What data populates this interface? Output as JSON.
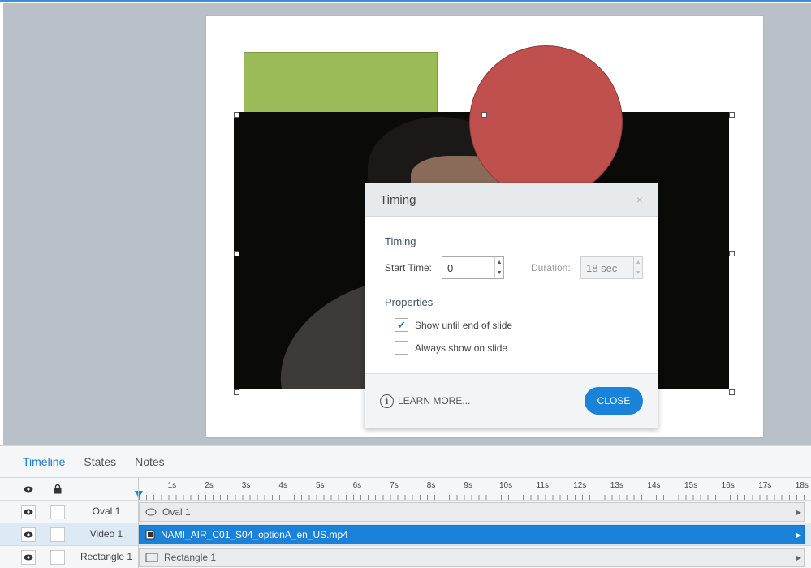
{
  "dialog": {
    "title": "Timing",
    "timing_section": "Timing",
    "start_time_label": "Start Time:",
    "start_time_value": "0",
    "duration_label": "Duration:",
    "duration_value": "18 sec",
    "properties_section": "Properties",
    "checkbox_show_until_end": {
      "label": "Show until end of slide",
      "checked": true
    },
    "checkbox_always_show": {
      "label": "Always show on slide",
      "checked": false
    },
    "learn_more": "LEARN MORE...",
    "close_button": "CLOSE",
    "close_icon": "×"
  },
  "panel": {
    "tabs": [
      {
        "label": "Timeline",
        "active": true
      },
      {
        "label": "States",
        "active": false
      },
      {
        "label": "Notes",
        "active": false
      }
    ],
    "ruler_labels": [
      "1s",
      "2s",
      "3s",
      "4s",
      "5s",
      "6s",
      "7s",
      "8s",
      "9s",
      "10s",
      "11s",
      "12s",
      "13s",
      "14s",
      "15s",
      "16s",
      "17s",
      "18s"
    ],
    "rows": [
      {
        "name": "Oval 1",
        "track_label": "Oval 1",
        "icon": "oval-icon",
        "selected": false
      },
      {
        "name": "Video 1",
        "track_label": "NAMI_AIR_C01_S04_optionA_en_US.mp4",
        "icon": "video-icon",
        "selected": true
      },
      {
        "name": "Rectangle 1",
        "track_label": "Rectangle 1",
        "icon": "rectangle-icon",
        "selected": false
      }
    ]
  },
  "colors": {
    "accent": "#1a82d9",
    "rectangle_fill": "#9bbb59",
    "oval_fill": "#c0504d",
    "stage_bg": "#b9c0c8"
  }
}
